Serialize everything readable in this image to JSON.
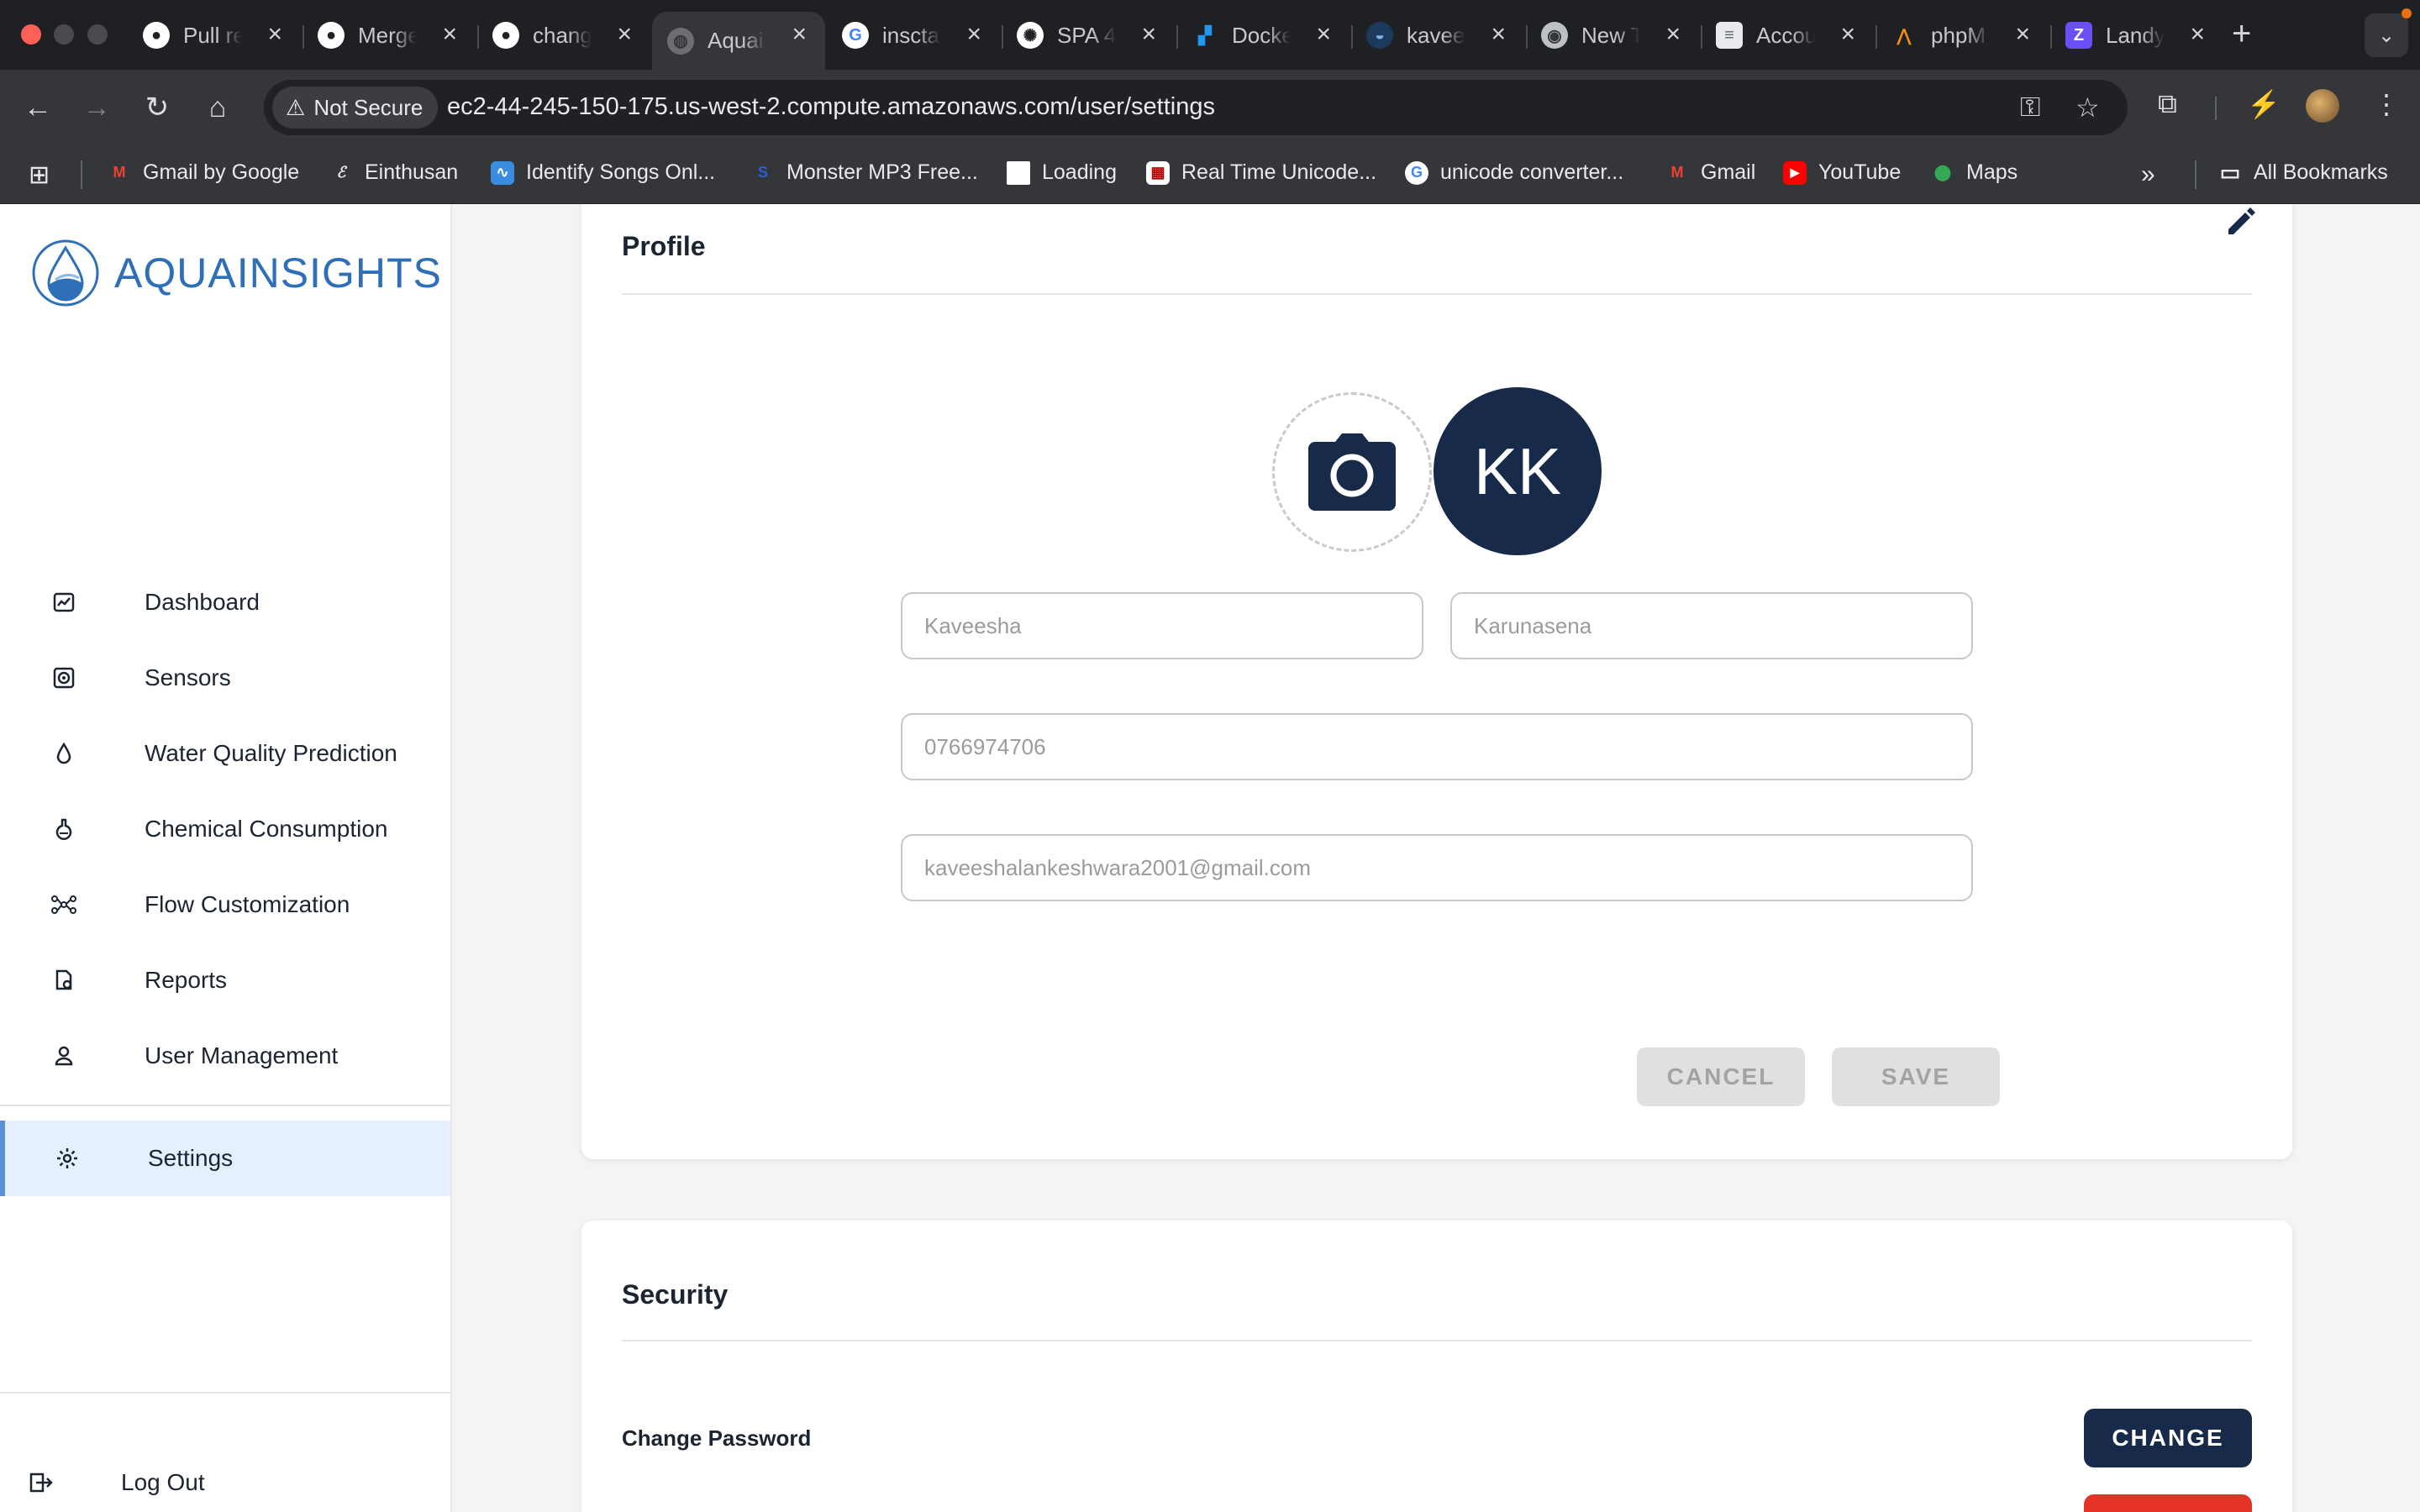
{
  "browser": {
    "tabs": [
      {
        "label": "Pull re",
        "icon": "github-icon",
        "active": false
      },
      {
        "label": "Merge",
        "icon": "github-icon",
        "active": false
      },
      {
        "label": "chang",
        "icon": "github-icon",
        "active": false
      },
      {
        "label": "Aquai",
        "icon": "globe-icon",
        "active": true
      },
      {
        "label": "inscta",
        "icon": "google-icon",
        "active": false
      },
      {
        "label": "SPA 4",
        "icon": "openai-icon",
        "active": false
      },
      {
        "label": "Docke",
        "icon": "docker-icon",
        "active": false
      },
      {
        "label": "kavee",
        "icon": "digitalocean-icon",
        "active": false
      },
      {
        "label": "New T",
        "icon": "chrome-icon",
        "active": false
      },
      {
        "label": "Accou",
        "icon": "database-icon",
        "active": false
      },
      {
        "label": "phpM",
        "icon": "phpmyadmin-icon",
        "active": false
      },
      {
        "label": "Landy",
        "icon": "zoho-icon",
        "active": false
      }
    ],
    "security_label": "Not Secure",
    "url": "ec2-44-245-150-175.us-west-2.compute.amazonaws.com/user/settings",
    "bookmarks": [
      {
        "label": "Gmail by Google",
        "icon": "gmail-icon"
      },
      {
        "label": "Einthusan",
        "icon": "einthusan-icon"
      },
      {
        "label": "Identify Songs Onl...",
        "icon": "waveform-icon"
      },
      {
        "label": "Monster MP3 Free...",
        "icon": "monster-icon"
      },
      {
        "label": "Loading",
        "icon": "blank-page-icon"
      },
      {
        "label": "Real Time Unicode...",
        "icon": "unicode-icon"
      },
      {
        "label": "unicode converter...",
        "icon": "google-icon"
      },
      {
        "label": "Gmail",
        "icon": "gmail-icon"
      },
      {
        "label": "YouTube",
        "icon": "youtube-icon"
      },
      {
        "label": "Maps",
        "icon": "maps-icon"
      }
    ],
    "all_bookmarks_label": "All Bookmarks"
  },
  "app": {
    "brand": "AQUAINSIGHTS",
    "nav": [
      {
        "label": "Dashboard",
        "icon": "dashboard-icon"
      },
      {
        "label": "Sensors",
        "icon": "sensor-icon"
      },
      {
        "label": "Water Quality Prediction",
        "icon": "water-drop-icon"
      },
      {
        "label": "Chemical Consumption",
        "icon": "flask-icon"
      },
      {
        "label": "Flow Customization",
        "icon": "flow-icon"
      },
      {
        "label": "Reports",
        "icon": "report-icon"
      },
      {
        "label": "User Management",
        "icon": "user-icon"
      }
    ],
    "settings_label": "Settings",
    "logout_label": "Log Out"
  },
  "profile": {
    "title": "Profile",
    "initials": "KK",
    "first_name": "Kaveesha",
    "last_name": "Karunasena",
    "phone": "0766974706",
    "email": "kaveeshalankeshwara2001@gmail.com",
    "cancel_label": "CANCEL",
    "save_label": "SAVE"
  },
  "security": {
    "title": "Security",
    "change_password_label": "Change Password",
    "change_label": "CHANGE"
  },
  "colors": {
    "primary_navy": "#172a4a",
    "danger_red": "#e53226",
    "active_nav_bg": "#e6f0fc",
    "brand_blue": "#2e6fb8"
  }
}
